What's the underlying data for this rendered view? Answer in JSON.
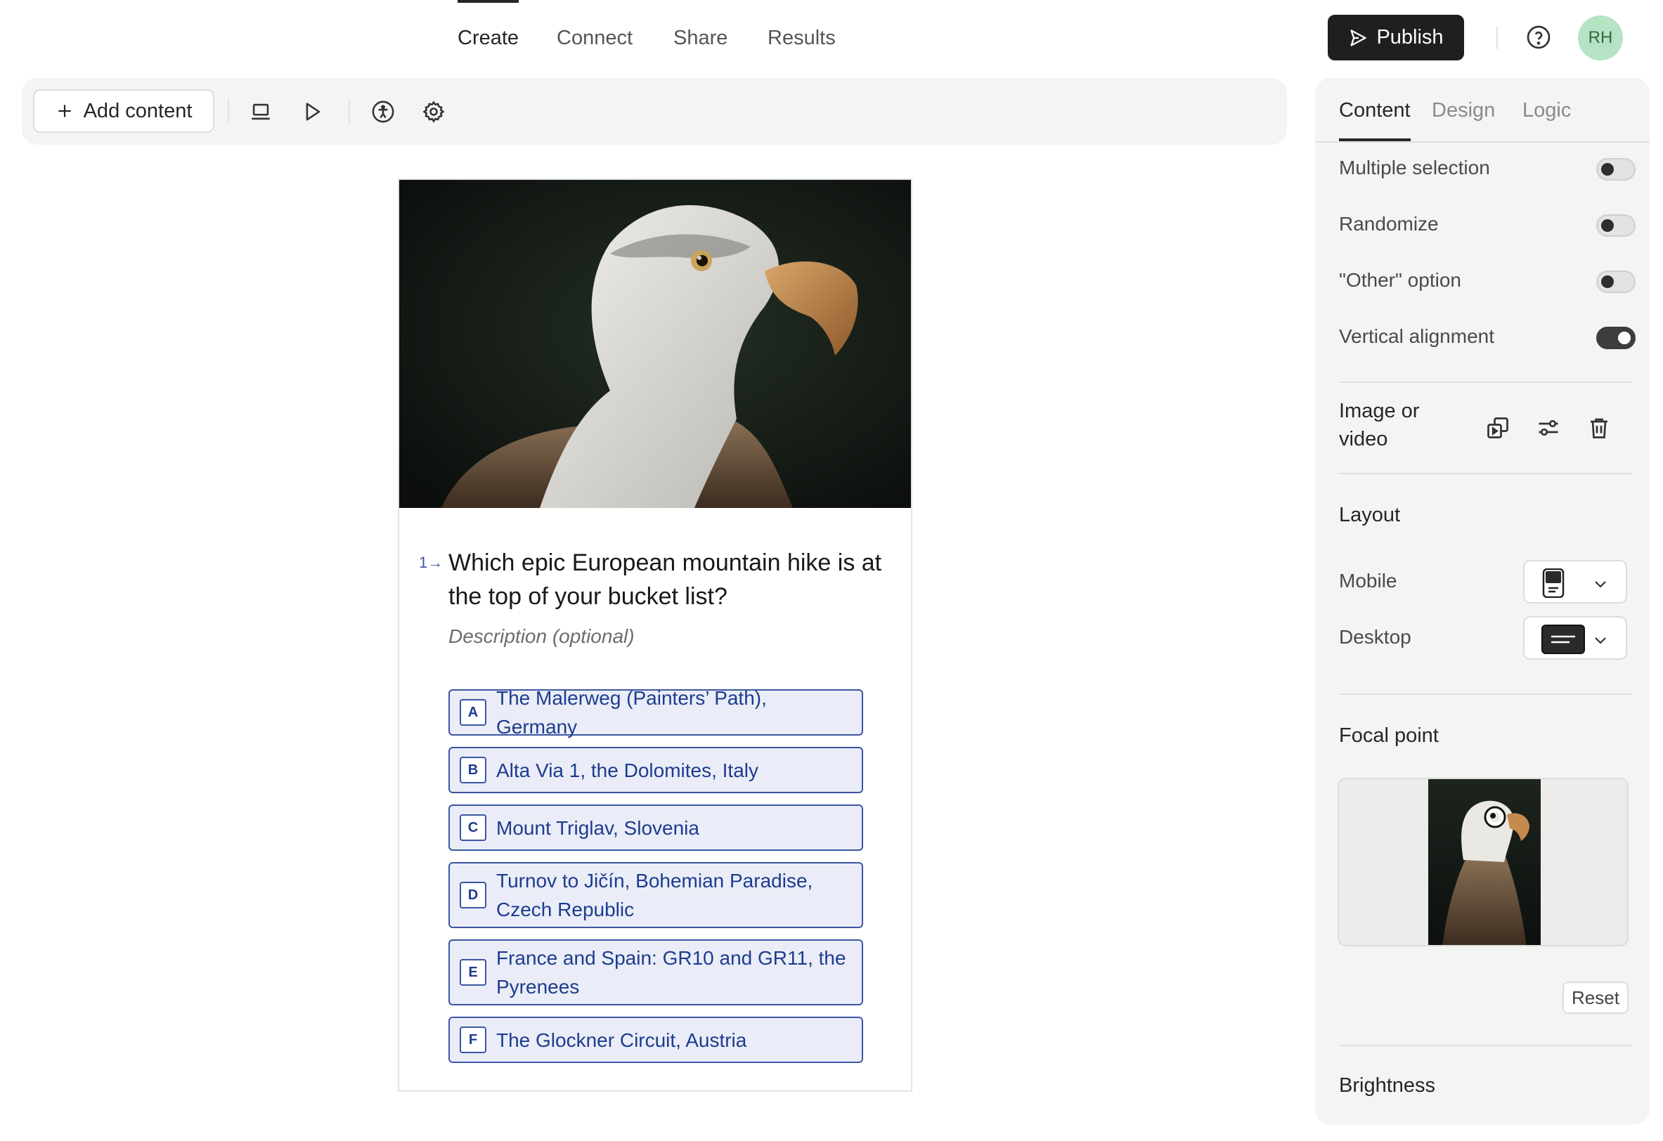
{
  "nav": {
    "tabs": [
      {
        "label": "Create"
      },
      {
        "label": "Connect"
      },
      {
        "label": "Share"
      },
      {
        "label": "Results"
      }
    ],
    "publish_label": "Publish",
    "avatar_initials": "RH"
  },
  "toolbar": {
    "add_content_label": "Add content"
  },
  "question": {
    "number": "1",
    "text": "Which epic European mountain hike is at the top of your bucket list?",
    "description_placeholder": "Description (optional)",
    "choices": [
      {
        "key": "A",
        "text": "The Malerweg (Painters’ Path), Germany"
      },
      {
        "key": "B",
        "text": "Alta Via 1, the Dolomites, Italy"
      },
      {
        "key": "C",
        "text": "Mount Triglav, Slovenia"
      },
      {
        "key": "D",
        "text": "Turnov to Jičín, Bohemian Paradise, Czech Republic"
      },
      {
        "key": "E",
        "text": "France and Spain: GR10 and GR11, the Pyrenees"
      },
      {
        "key": "F",
        "text": "The Glockner Circuit, Austria"
      }
    ]
  },
  "panel": {
    "tabs": [
      {
        "label": "Content"
      },
      {
        "label": "Design"
      },
      {
        "label": "Logic"
      }
    ],
    "settings": [
      {
        "label": "Multiple selection",
        "on": false
      },
      {
        "label": "Randomize",
        "on": false
      },
      {
        "label": "\"Other\" option",
        "on": false
      },
      {
        "label": "Vertical alignment",
        "on": true
      }
    ],
    "image_or_video_label": "Image or video",
    "layout": {
      "title": "Layout",
      "mobile_label": "Mobile",
      "desktop_label": "Desktop"
    },
    "focal_point": {
      "title": "Focal point",
      "reset_label": "Reset"
    },
    "brightness_title": "Brightness"
  },
  "colors": {
    "accent": "#3b55a3",
    "choice_bg": "#eaedf7",
    "publish_bg": "#1f1f1f",
    "avatar_bg": "#b5e3c4"
  }
}
